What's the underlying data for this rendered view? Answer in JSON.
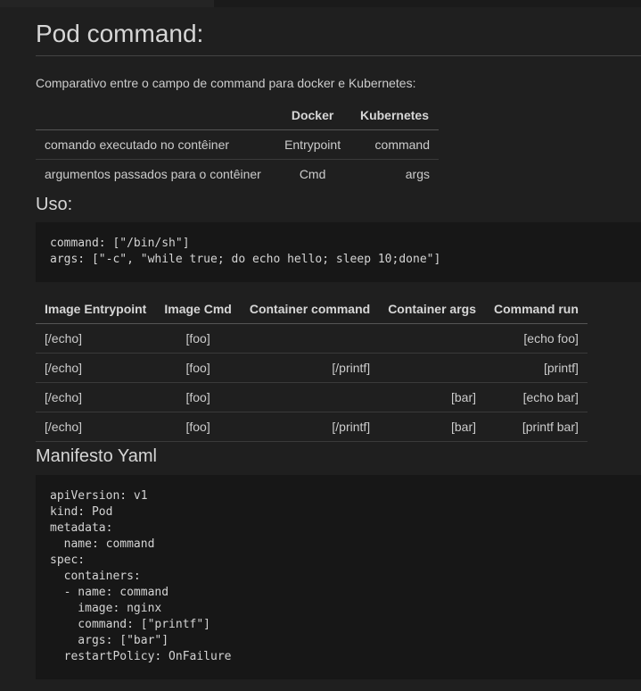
{
  "title": "Pod command:",
  "intro": "Comparativo entre o campo de command para docker e Kubernetes:",
  "compare_table": {
    "headers": [
      "",
      "Docker",
      "Kubernetes"
    ],
    "rows": [
      [
        "comando executado no contêiner",
        "Entrypoint",
        "command"
      ],
      [
        "argumentos passados para o contêiner",
        "Cmd",
        "args"
      ]
    ]
  },
  "uso_heading": "Uso:",
  "uso_code": "command: [\"/bin/sh\"]\nargs: [\"-c\", \"while true; do echo hello; sleep 10;done\"]",
  "behavior_table": {
    "headers": [
      "Image Entrypoint",
      "Image Cmd",
      "Container command",
      "Container args",
      "Command run"
    ],
    "rows": [
      [
        "[/echo]",
        "[foo]",
        "",
        "",
        "[echo foo]"
      ],
      [
        "[/echo]",
        "[foo]",
        "[/printf]",
        "",
        "[printf]"
      ],
      [
        "[/echo]",
        "[foo]",
        "",
        "[bar]",
        "[echo bar]"
      ],
      [
        "[/echo]",
        "[foo]",
        "[/printf]",
        "[bar]",
        "[printf bar]"
      ]
    ]
  },
  "manifesto_heading": "Manifesto Yaml",
  "manifesto_code": "apiVersion: v1\nkind: Pod\nmetadata:\n  name: command\nspec:\n  containers:\n  - name: command\n    image: nginx\n    command: [\"printf\"]\n    args: [\"bar\"]\n  restartPolicy: OnFailure"
}
